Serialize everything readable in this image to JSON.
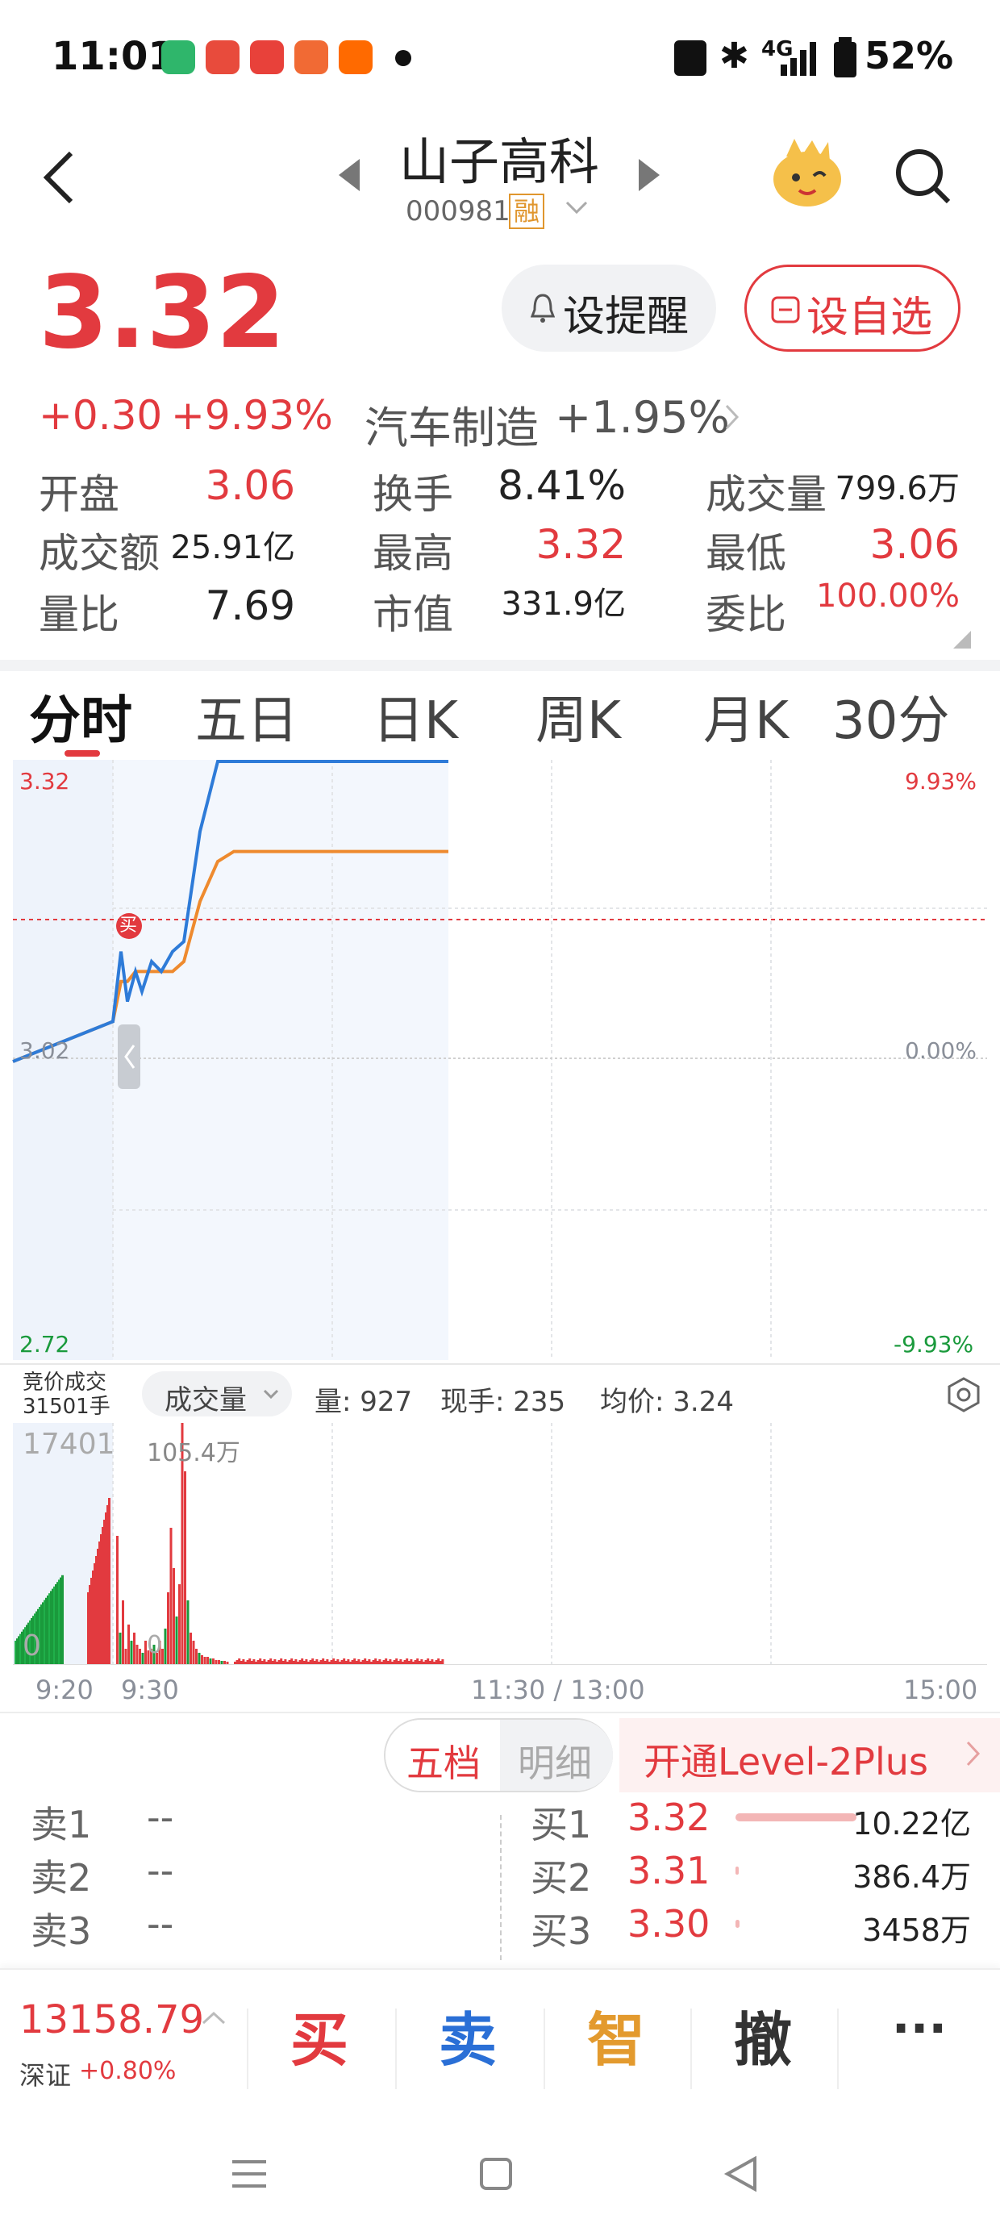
{
  "status_bar": {
    "time": "11:01",
    "network": "4G",
    "battery": "52%",
    "app_icons": [
      "iqiyi-icon",
      "video-icon",
      "toutiao-icon",
      "app-icon",
      "taobao-icon"
    ]
  },
  "header": {
    "stock_name": "山子高科",
    "stock_code": "000981",
    "margin_badge": "融"
  },
  "quote": {
    "price": "3.32",
    "change": "+0.30",
    "change_pct": "+9.93%",
    "alert_button": "设提醒",
    "watchlist_button": "设自选",
    "industry": "汽车制造",
    "industry_change": "+1.95%"
  },
  "stats": [
    {
      "label": "开盘",
      "value": "3.06"
    },
    {
      "label": "换手",
      "value": "8.41%"
    },
    {
      "label": "成交量",
      "value": "799.6万"
    },
    {
      "label": "成交额",
      "value": "25.91亿"
    },
    {
      "label": "最高",
      "value": "3.32"
    },
    {
      "label": "最低",
      "value": "3.06"
    },
    {
      "label": "量比",
      "value": "7.69"
    },
    {
      "label": "市值",
      "value": "331.9亿"
    },
    {
      "label": "委比",
      "value": "100.00%"
    }
  ],
  "tabs": [
    "分时",
    "五日",
    "日K",
    "周K",
    "月K",
    "30分"
  ],
  "chart_labels": {
    "price_high": "3.32",
    "price_mid": "3.02",
    "price_low": "2.72",
    "pct_high": "9.93%",
    "pct_mid": "0.00%",
    "pct_low": "-9.93%",
    "buy_marker": "买"
  },
  "volume_bar": {
    "auction_label": "竞价成交",
    "auction_volume": "31501手",
    "dropdown": "成交量",
    "vol": "量: 927",
    "current_hand": "现手: 235",
    "avg_price": "均价: 3.24",
    "left_max": "17401",
    "peak": "105.4万",
    "zero": "0",
    "zero2": "0"
  },
  "time_axis": [
    "9:20",
    "9:30",
    "11:30 / 13:00",
    "15:00"
  ],
  "chart_data": {
    "type": "line",
    "x": [
      "9:20",
      "9:30",
      "9:31",
      "9:32",
      "9:33",
      "9:34",
      "9:35",
      "9:36",
      "9:37",
      "9:38",
      "9:40",
      "9:45",
      "9:50",
      "10:00",
      "10:30",
      "11:00"
    ],
    "series": [
      {
        "values": [
          3.02,
          3.06,
          3.13,
          3.08,
          3.11,
          3.09,
          3.12,
          3.11,
          3.13,
          3.14,
          3.25,
          3.32,
          3.32,
          3.32,
          3.32,
          3.32
        ]
      },
      {
        "values": [
          3.02,
          3.06,
          3.1,
          3.1,
          3.11,
          3.11,
          3.11,
          3.11,
          3.11,
          3.12,
          3.18,
          3.22,
          3.23,
          3.23,
          3.23,
          3.23
        ]
      }
    ],
    "ylim": [
      2.72,
      3.32
    ]
  },
  "order_book": {
    "tab_five": "五档",
    "tab_detail": "明细",
    "level2": "开通Level-2Plus",
    "sell": [
      {
        "label": "卖1",
        "price": "--"
      },
      {
        "label": "卖2",
        "price": "--"
      },
      {
        "label": "卖3",
        "price": "--"
      }
    ],
    "buy": [
      {
        "label": "买1",
        "price": "3.32",
        "vol": "10.22亿",
        "bar": 1.0
      },
      {
        "label": "买2",
        "price": "3.31",
        "vol": "386.4万",
        "bar": 0.01
      },
      {
        "label": "买3",
        "price": "3.30",
        "vol": "3458万",
        "bar": 0.03
      }
    ]
  },
  "bottom": {
    "index_value": "13158.79",
    "index_name": "深证",
    "index_change": "+0.80%",
    "buy": "买",
    "sell": "卖",
    "smart": "智",
    "cancel": "撤",
    "more": "···"
  }
}
